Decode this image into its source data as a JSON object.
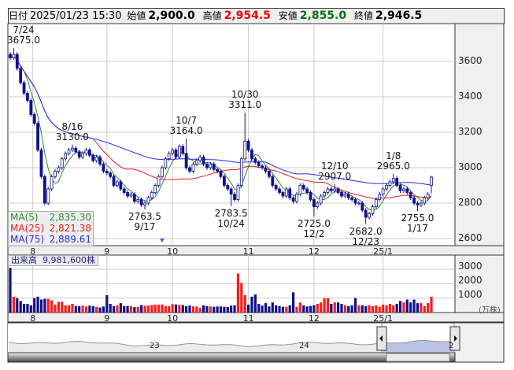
{
  "header": {
    "date_label": "日付",
    "date": "2025/01/23 15:30",
    "open_label": "始値",
    "open": "2,900.0",
    "high_label": "高値",
    "high": "2,954.5",
    "low_label": "安値",
    "low": "2,855.0",
    "close_label": "終値",
    "close": "2,946.5"
  },
  "colors": {
    "up_vol": "#ff1a1a",
    "down_vol": "#10108a",
    "candle": "#10108a",
    "ma5": "#2e8b2e",
    "ma25": "#e81c1c",
    "ma75": "#2a2ae8"
  },
  "legend": [
    {
      "label": "MA(5)",
      "value": "2,835.30"
    },
    {
      "label": "MA(25)",
      "value": "2,821.38"
    },
    {
      "label": "MA(75)",
      "value": "2,889.61"
    }
  ],
  "price_axis": [
    "3600",
    "3400",
    "3200",
    "3000",
    "2800",
    "2600"
  ],
  "price_axis_values": [
    3600,
    3400,
    3200,
    3000,
    2800,
    2600
  ],
  "month_labels": [
    "8",
    "9",
    "10",
    "11",
    "12",
    "25/1"
  ],
  "month_start_index": [
    7,
    28,
    47,
    69,
    88,
    108
  ],
  "volume": {
    "label": "出来高",
    "value": "9,981,600株",
    "axis": [
      "3000",
      "2000",
      "1000"
    ],
    "unit": "(万株)"
  },
  "annotations": [
    {
      "index": 1,
      "type": "high",
      "date": "7/24",
      "value": "3675.0",
      "price": 3675
    },
    {
      "index": 18,
      "type": "high",
      "date": "8/16",
      "value": "3130.0",
      "price": 3130
    },
    {
      "index": 39,
      "type": "low",
      "date": "9/17",
      "value": "2763.5",
      "price": 2763.5
    },
    {
      "index": 51,
      "type": "high",
      "date": "10/7",
      "value": "3164.0",
      "price": 3164
    },
    {
      "index": 64,
      "type": "low",
      "date": "10/24",
      "value": "2783.5",
      "price": 2783.5
    },
    {
      "index": 68,
      "type": "high",
      "date": "10/30",
      "value": "3311.0",
      "price": 3311
    },
    {
      "index": 88,
      "type": "low",
      "date": "12/2",
      "value": "2725.0",
      "price": 2725
    },
    {
      "index": 94,
      "type": "high",
      "date": "12/10",
      "value": "2907.0",
      "price": 2907
    },
    {
      "index": 103,
      "type": "low",
      "date": "12/23",
      "value": "2682.0",
      "price": 2682
    },
    {
      "index": 111,
      "type": "high",
      "date": "1/8",
      "value": "2965.0",
      "price": 2965
    },
    {
      "index": 118,
      "type": "low",
      "date": "1/17",
      "value": "2755.0",
      "price": 2755
    }
  ],
  "navigator": {
    "labels": [
      "23",
      "24",
      "2"
    ]
  },
  "chart_data": {
    "type": "candlestick",
    "last": {
      "open": 2900,
      "high": 2954.5,
      "low": 2855,
      "close": 2946.5
    },
    "closes": [
      3620,
      3640,
      3560,
      3480,
      3420,
      3380,
      3300,
      3250,
      3100,
      2950,
      2800,
      2880,
      2950,
      2980,
      3000,
      3050,
      3080,
      3100,
      3110,
      3090,
      3060,
      3080,
      3100,
      3070,
      3040,
      3060,
      3020,
      2980,
      2970,
      2950,
      2900,
      2920,
      2880,
      2860,
      2840,
      2850,
      2810,
      2820,
      2790,
      2800,
      2830,
      2860,
      2900,
      2950,
      3000,
      3050,
      3080,
      3100,
      3060,
      3120,
      3080,
      3000,
      2980,
      3020,
      3040,
      3060,
      3020,
      3000,
      3020,
      2990,
      2980,
      2950,
      2900,
      2880,
      2850,
      2820,
      2900,
      3050,
      3150,
      3100,
      3050,
      3030,
      3010,
      3000,
      2980,
      2950,
      2900,
      2880,
      2860,
      2840,
      2880,
      2830,
      2810,
      2850,
      2900,
      2880,
      2860,
      2820,
      2780,
      2800,
      2840,
      2860,
      2880,
      2870,
      2880,
      2860,
      2840,
      2850,
      2830,
      2820,
      2800,
      2800,
      2760,
      2720,
      2740,
      2780,
      2820,
      2850,
      2880,
      2900,
      2920,
      2940,
      2900,
      2870,
      2880,
      2860,
      2830,
      2800,
      2790,
      2800,
      2830,
      2850,
      2946.5
    ],
    "volumes": [
      3100,
      1100,
      1000,
      800,
      600,
      600,
      500,
      1000,
      1100,
      900,
      950,
      950,
      850,
      550,
      750,
      750,
      500,
      500,
      600,
      450,
      450,
      480,
      420,
      480,
      450,
      400,
      350,
      420,
      1200,
      600,
      450,
      500,
      650,
      450,
      450,
      450,
      380,
      400,
      520,
      480,
      480,
      520,
      550,
      550,
      560,
      450,
      450,
      580,
      560,
      520,
      520,
      450,
      480,
      430,
      420,
      320,
      500,
      450,
      420,
      400,
      420,
      420,
      400,
      380,
      480,
      500,
      2700,
      2050,
      1200,
      550,
      1100,
      1250,
      600,
      480,
      650,
      420,
      700,
      500,
      450,
      400,
      400,
      500,
      1400,
      400,
      700,
      500,
      420,
      450,
      500,
      600,
      700,
      1000,
      1000,
      600,
      700,
      700,
      600,
      500,
      450,
      500,
      1000,
      500,
      500,
      450,
      500,
      450,
      500,
      400,
      550,
      500,
      600,
      500,
      600,
      800,
      700,
      900,
      700,
      900,
      650,
      650,
      450,
      650,
      1100
    ],
    "ma_periods": [
      5,
      25,
      75
    ],
    "ylim": [
      2560,
      3720
    ],
    "volume_ylim": [
      0,
      3000
    ]
  }
}
